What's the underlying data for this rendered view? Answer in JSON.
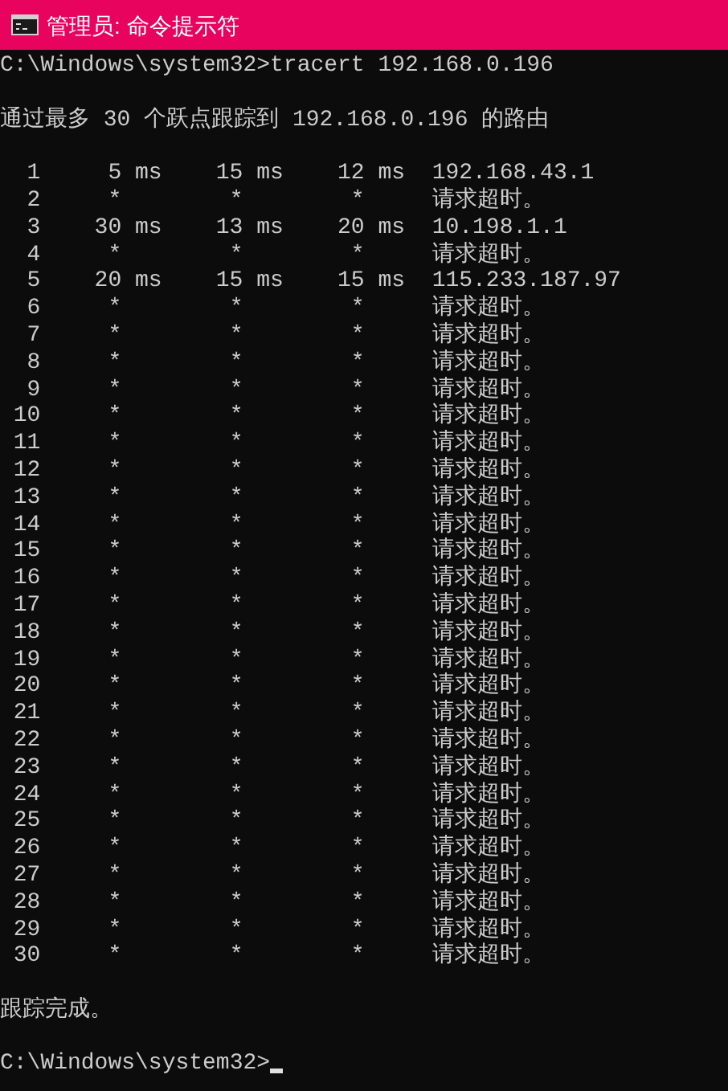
{
  "window": {
    "title": "管理员: 命令提示符"
  },
  "console": {
    "command_line": "C:\\Windows\\system32>tracert 192.168.0.196",
    "header": "通过最多 30 个跃点跟踪到 192.168.0.196 的路由",
    "hops": [
      {
        "hop": "1",
        "times": [
          {
            "kind": "reply",
            "text": "5 ms"
          },
          {
            "kind": "reply",
            "text": "15 ms"
          },
          {
            "kind": "reply",
            "text": "12 ms"
          }
        ],
        "host": "192.168.43.1"
      },
      {
        "hop": "2",
        "times": [
          {
            "kind": "timeout",
            "text": "*"
          },
          {
            "kind": "timeout",
            "text": "*"
          },
          {
            "kind": "timeout",
            "text": "*"
          }
        ],
        "host": "请求超时。"
      },
      {
        "hop": "3",
        "times": [
          {
            "kind": "reply",
            "text": "30 ms"
          },
          {
            "kind": "reply",
            "text": "13 ms"
          },
          {
            "kind": "reply",
            "text": "20 ms"
          }
        ],
        "host": "10.198.1.1"
      },
      {
        "hop": "4",
        "times": [
          {
            "kind": "timeout",
            "text": "*"
          },
          {
            "kind": "timeout",
            "text": "*"
          },
          {
            "kind": "timeout",
            "text": "*"
          }
        ],
        "host": "请求超时。"
      },
      {
        "hop": "5",
        "times": [
          {
            "kind": "reply",
            "text": "20 ms"
          },
          {
            "kind": "reply",
            "text": "15 ms"
          },
          {
            "kind": "reply",
            "text": "15 ms"
          }
        ],
        "host": "115.233.187.97"
      },
      {
        "hop": "6",
        "times": [
          {
            "kind": "timeout",
            "text": "*"
          },
          {
            "kind": "timeout",
            "text": "*"
          },
          {
            "kind": "timeout",
            "text": "*"
          }
        ],
        "host": "请求超时。"
      },
      {
        "hop": "7",
        "times": [
          {
            "kind": "timeout",
            "text": "*"
          },
          {
            "kind": "timeout",
            "text": "*"
          },
          {
            "kind": "timeout",
            "text": "*"
          }
        ],
        "host": "请求超时。"
      },
      {
        "hop": "8",
        "times": [
          {
            "kind": "timeout",
            "text": "*"
          },
          {
            "kind": "timeout",
            "text": "*"
          },
          {
            "kind": "timeout",
            "text": "*"
          }
        ],
        "host": "请求超时。"
      },
      {
        "hop": "9",
        "times": [
          {
            "kind": "timeout",
            "text": "*"
          },
          {
            "kind": "timeout",
            "text": "*"
          },
          {
            "kind": "timeout",
            "text": "*"
          }
        ],
        "host": "请求超时。"
      },
      {
        "hop": "10",
        "times": [
          {
            "kind": "timeout",
            "text": "*"
          },
          {
            "kind": "timeout",
            "text": "*"
          },
          {
            "kind": "timeout",
            "text": "*"
          }
        ],
        "host": "请求超时。"
      },
      {
        "hop": "11",
        "times": [
          {
            "kind": "timeout",
            "text": "*"
          },
          {
            "kind": "timeout",
            "text": "*"
          },
          {
            "kind": "timeout",
            "text": "*"
          }
        ],
        "host": "请求超时。"
      },
      {
        "hop": "12",
        "times": [
          {
            "kind": "timeout",
            "text": "*"
          },
          {
            "kind": "timeout",
            "text": "*"
          },
          {
            "kind": "timeout",
            "text": "*"
          }
        ],
        "host": "请求超时。"
      },
      {
        "hop": "13",
        "times": [
          {
            "kind": "timeout",
            "text": "*"
          },
          {
            "kind": "timeout",
            "text": "*"
          },
          {
            "kind": "timeout",
            "text": "*"
          }
        ],
        "host": "请求超时。"
      },
      {
        "hop": "14",
        "times": [
          {
            "kind": "timeout",
            "text": "*"
          },
          {
            "kind": "timeout",
            "text": "*"
          },
          {
            "kind": "timeout",
            "text": "*"
          }
        ],
        "host": "请求超时。"
      },
      {
        "hop": "15",
        "times": [
          {
            "kind": "timeout",
            "text": "*"
          },
          {
            "kind": "timeout",
            "text": "*"
          },
          {
            "kind": "timeout",
            "text": "*"
          }
        ],
        "host": "请求超时。"
      },
      {
        "hop": "16",
        "times": [
          {
            "kind": "timeout",
            "text": "*"
          },
          {
            "kind": "timeout",
            "text": "*"
          },
          {
            "kind": "timeout",
            "text": "*"
          }
        ],
        "host": "请求超时。"
      },
      {
        "hop": "17",
        "times": [
          {
            "kind": "timeout",
            "text": "*"
          },
          {
            "kind": "timeout",
            "text": "*"
          },
          {
            "kind": "timeout",
            "text": "*"
          }
        ],
        "host": "请求超时。"
      },
      {
        "hop": "18",
        "times": [
          {
            "kind": "timeout",
            "text": "*"
          },
          {
            "kind": "timeout",
            "text": "*"
          },
          {
            "kind": "timeout",
            "text": "*"
          }
        ],
        "host": "请求超时。"
      },
      {
        "hop": "19",
        "times": [
          {
            "kind": "timeout",
            "text": "*"
          },
          {
            "kind": "timeout",
            "text": "*"
          },
          {
            "kind": "timeout",
            "text": "*"
          }
        ],
        "host": "请求超时。"
      },
      {
        "hop": "20",
        "times": [
          {
            "kind": "timeout",
            "text": "*"
          },
          {
            "kind": "timeout",
            "text": "*"
          },
          {
            "kind": "timeout",
            "text": "*"
          }
        ],
        "host": "请求超时。"
      },
      {
        "hop": "21",
        "times": [
          {
            "kind": "timeout",
            "text": "*"
          },
          {
            "kind": "timeout",
            "text": "*"
          },
          {
            "kind": "timeout",
            "text": "*"
          }
        ],
        "host": "请求超时。"
      },
      {
        "hop": "22",
        "times": [
          {
            "kind": "timeout",
            "text": "*"
          },
          {
            "kind": "timeout",
            "text": "*"
          },
          {
            "kind": "timeout",
            "text": "*"
          }
        ],
        "host": "请求超时。"
      },
      {
        "hop": "23",
        "times": [
          {
            "kind": "timeout",
            "text": "*"
          },
          {
            "kind": "timeout",
            "text": "*"
          },
          {
            "kind": "timeout",
            "text": "*"
          }
        ],
        "host": "请求超时。"
      },
      {
        "hop": "24",
        "times": [
          {
            "kind": "timeout",
            "text": "*"
          },
          {
            "kind": "timeout",
            "text": "*"
          },
          {
            "kind": "timeout",
            "text": "*"
          }
        ],
        "host": "请求超时。"
      },
      {
        "hop": "25",
        "times": [
          {
            "kind": "timeout",
            "text": "*"
          },
          {
            "kind": "timeout",
            "text": "*"
          },
          {
            "kind": "timeout",
            "text": "*"
          }
        ],
        "host": "请求超时。"
      },
      {
        "hop": "26",
        "times": [
          {
            "kind": "timeout",
            "text": "*"
          },
          {
            "kind": "timeout",
            "text": "*"
          },
          {
            "kind": "timeout",
            "text": "*"
          }
        ],
        "host": "请求超时。"
      },
      {
        "hop": "27",
        "times": [
          {
            "kind": "timeout",
            "text": "*"
          },
          {
            "kind": "timeout",
            "text": "*"
          },
          {
            "kind": "timeout",
            "text": "*"
          }
        ],
        "host": "请求超时。"
      },
      {
        "hop": "28",
        "times": [
          {
            "kind": "timeout",
            "text": "*"
          },
          {
            "kind": "timeout",
            "text": "*"
          },
          {
            "kind": "timeout",
            "text": "*"
          }
        ],
        "host": "请求超时。"
      },
      {
        "hop": "29",
        "times": [
          {
            "kind": "timeout",
            "text": "*"
          },
          {
            "kind": "timeout",
            "text": "*"
          },
          {
            "kind": "timeout",
            "text": "*"
          }
        ],
        "host": "请求超时。"
      },
      {
        "hop": "30",
        "times": [
          {
            "kind": "timeout",
            "text": "*"
          },
          {
            "kind": "timeout",
            "text": "*"
          },
          {
            "kind": "timeout",
            "text": "*"
          }
        ],
        "host": "请求超时。"
      }
    ],
    "footer": "跟踪完成。",
    "prompt": "C:\\Windows\\system32>"
  }
}
